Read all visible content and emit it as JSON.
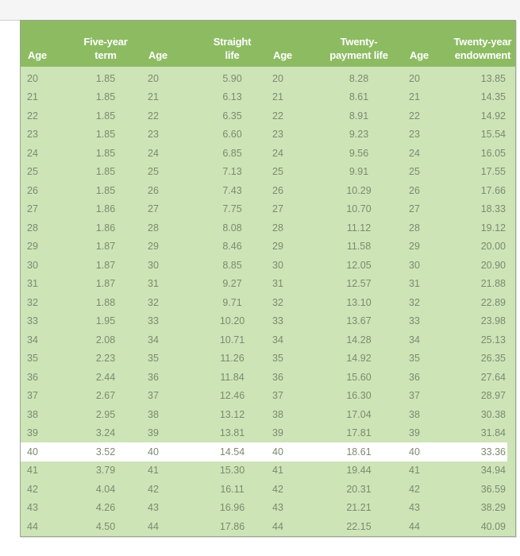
{
  "table": {
    "headers": [
      {
        "line1": "",
        "line2": "Age"
      },
      {
        "line1": "Five-year",
        "line2": "term"
      },
      {
        "line1": "",
        "line2": "Age"
      },
      {
        "line1": "Straight",
        "line2": "life"
      },
      {
        "line1": "",
        "line2": "Age"
      },
      {
        "line1": "Twenty-",
        "line2": "payment life"
      },
      {
        "line1": "",
        "line2": "Age"
      },
      {
        "line1": "Twenty-year",
        "line2": "endowment"
      }
    ],
    "highlighted_age": "40",
    "rows": [
      [
        "20",
        "1.85",
        "20",
        "5.90",
        "20",
        "8.28",
        "20",
        "13.85"
      ],
      [
        "21",
        "1.85",
        "21",
        "6.13",
        "21",
        "8.61",
        "21",
        "14.35"
      ],
      [
        "22",
        "1.85",
        "22",
        "6.35",
        "22",
        "8.91",
        "22",
        "14.92"
      ],
      [
        "23",
        "1.85",
        "23",
        "6.60",
        "23",
        "9.23",
        "23",
        "15.54"
      ],
      [
        "24",
        "1.85",
        "24",
        "6.85",
        "24",
        "9.56",
        "24",
        "16.05"
      ],
      [
        "25",
        "1.85",
        "25",
        "7.13",
        "25",
        "9.91",
        "25",
        "17.55"
      ],
      [
        "26",
        "1.85",
        "26",
        "7.43",
        "26",
        "10.29",
        "26",
        "17.66"
      ],
      [
        "27",
        "1.86",
        "27",
        "7.75",
        "27",
        "10.70",
        "27",
        "18.33"
      ],
      [
        "28",
        "1.86",
        "28",
        "8.08",
        "28",
        "11.12",
        "28",
        "19.12"
      ],
      [
        "29",
        "1.87",
        "29",
        "8.46",
        "29",
        "11.58",
        "29",
        "20.00"
      ],
      [
        "30",
        "1.87",
        "30",
        "8.85",
        "30",
        "12.05",
        "30",
        "20.90"
      ],
      [
        "31",
        "1.87",
        "31",
        "9.27",
        "31",
        "12.57",
        "31",
        "21.88"
      ],
      [
        "32",
        "1.88",
        "32",
        "9.71",
        "32",
        "13.10",
        "32",
        "22.89"
      ],
      [
        "33",
        "1.95",
        "33",
        "10.20",
        "33",
        "13.67",
        "33",
        "23.98"
      ],
      [
        "34",
        "2.08",
        "34",
        "10.71",
        "34",
        "14.28",
        "34",
        "25.13"
      ],
      [
        "35",
        "2.23",
        "35",
        "11.26",
        "35",
        "14.92",
        "35",
        "26.35"
      ],
      [
        "36",
        "2.44",
        "36",
        "11.84",
        "36",
        "15.60",
        "36",
        "27.64"
      ],
      [
        "37",
        "2.67",
        "37",
        "12.46",
        "37",
        "16.30",
        "37",
        "28.97"
      ],
      [
        "38",
        "2.95",
        "38",
        "13.12",
        "38",
        "17.04",
        "38",
        "30.38"
      ],
      [
        "39",
        "3.24",
        "39",
        "13.81",
        "39",
        "17.81",
        "39",
        "31.84"
      ],
      [
        "40",
        "3.52",
        "40",
        "14.54",
        "40",
        "18.61",
        "40",
        "33.36"
      ],
      [
        "41",
        "3.79",
        "41",
        "15.30",
        "41",
        "19.44",
        "41",
        "34.94"
      ],
      [
        "42",
        "4.04",
        "42",
        "16.11",
        "42",
        "20.31",
        "42",
        "36.59"
      ],
      [
        "43",
        "4.26",
        "43",
        "16.96",
        "43",
        "21.21",
        "43",
        "38.29"
      ],
      [
        "44",
        "4.50",
        "44",
        "17.86",
        "44",
        "22.15",
        "44",
        "40.09"
      ]
    ]
  },
  "colors": {
    "header_bg": "#8dbb62",
    "body_bg": "#cde4b7",
    "highlight_bg": "#ffffff",
    "text": "#7b8a70"
  }
}
